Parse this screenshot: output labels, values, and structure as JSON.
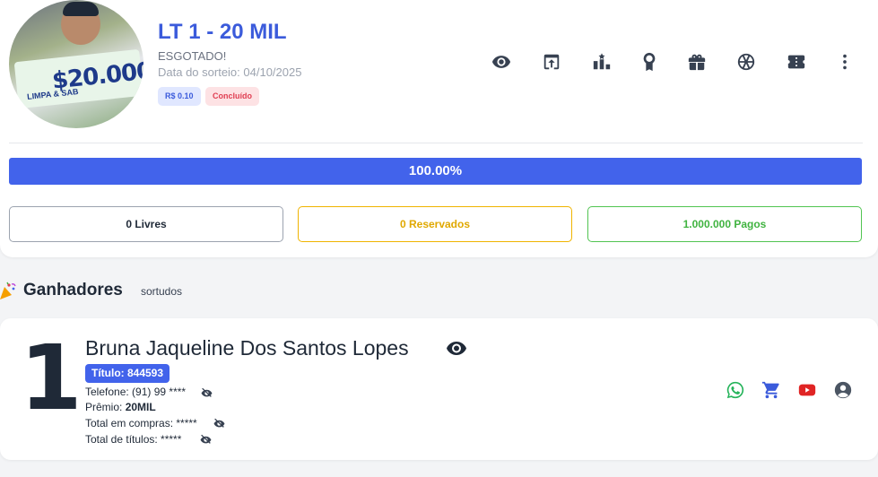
{
  "raffle": {
    "title": "LT 1 - 20 MIL",
    "status": "ESGOTADO!",
    "draw_date": "Data do sorteio: 04/10/2025",
    "price_badge": "R$ 0.10",
    "status_badge": "Concluído",
    "avatar_prize_text": "$20.000",
    "avatar_sub_text": "LIMPA & SAB"
  },
  "toolbar_icons": [
    "eye-icon",
    "share-icon",
    "ranking-icon",
    "award-icon",
    "gift-icon",
    "wheel-icon",
    "ticket-icon",
    "more-vert-icon"
  ],
  "progress": {
    "label": "100.00%",
    "value": 1.0
  },
  "counters": {
    "free": "0 Livres",
    "reserved": "0 Reservados",
    "paid": "1.000.000 Pagos"
  },
  "winners_section": {
    "title": "Ganhadores",
    "subtitle": "sortudos"
  },
  "winner": {
    "rank": "1",
    "name": "Bruna Jaqueline Dos Santos Lopes",
    "ticket": "Título: 844593",
    "phone": "Telefone: (91) 99 ****",
    "prize_label": "Prêmio: ",
    "prize_value": "20MIL",
    "total_purchases": "Total em compras: *****",
    "total_tickets": "Total de títulos: *****"
  },
  "colors": {
    "primary": "#4263eb",
    "title": "#3b5bdb",
    "reserved": "#e0a800",
    "paid": "#40b340",
    "whatsapp": "#25b35a",
    "youtube": "#e02424"
  }
}
